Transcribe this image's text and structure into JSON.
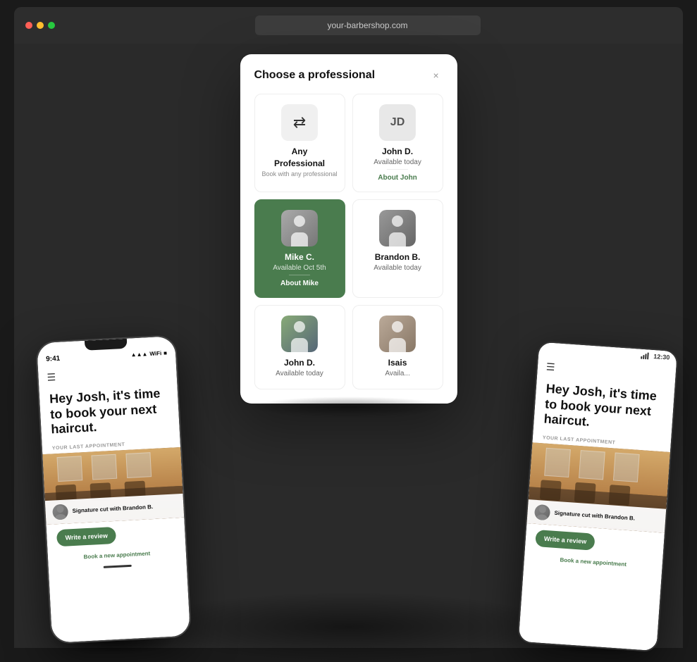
{
  "browser": {
    "url": "your-barbershop.com",
    "dots": [
      "red",
      "yellow",
      "green"
    ]
  },
  "modal": {
    "title": "Choose a professional",
    "close_label": "×",
    "professionals": [
      {
        "id": "any",
        "name": "Any Professional",
        "availability": "",
        "description": "Book with any professional",
        "link": "",
        "avatar_type": "shuffle",
        "selected": false
      },
      {
        "id": "john-d",
        "name": "John D.",
        "availability": "Available today",
        "description": "",
        "link": "About John",
        "avatar_type": "initials",
        "initials": "JD",
        "selected": false
      },
      {
        "id": "mike-c",
        "name": "Mike C.",
        "availability": "Available Oct 5th",
        "description": "",
        "link": "About Mike",
        "avatar_type": "photo",
        "selected": true
      },
      {
        "id": "brandon-b",
        "name": "Brandon B.",
        "availability": "Available today",
        "description": "",
        "link": "",
        "avatar_type": "photo",
        "selected": false
      },
      {
        "id": "john-d2",
        "name": "John D.",
        "availability": "Available today",
        "description": "",
        "link": "",
        "avatar_type": "photo",
        "selected": false
      },
      {
        "id": "isais",
        "name": "Isais",
        "availability": "Availa...",
        "description": "",
        "link": "",
        "avatar_type": "photo",
        "selected": false
      }
    ]
  },
  "phone_left": {
    "time": "9:41",
    "headline": "Hey Josh, it's time to book your next haircut.",
    "last_appointment_label": "YOUR LAST APPOINTMENT",
    "appointment_title": "Signature cut with Brandon B.",
    "write_review_btn": "Write a review",
    "book_appointment_link": "Book a new appointment",
    "menu_icon": "☰"
  },
  "phone_right": {
    "time": "12:30",
    "headline": "Hey Josh, it's time to book your next haircut.",
    "last_appointment_label": "YOUR LAST APPOINTMENT",
    "appointment_title": "Signature cut with Brandon B.",
    "write_review_btn": "Write a review",
    "book_appointment_link": "Book a new appointment",
    "menu_icon": "☰"
  }
}
